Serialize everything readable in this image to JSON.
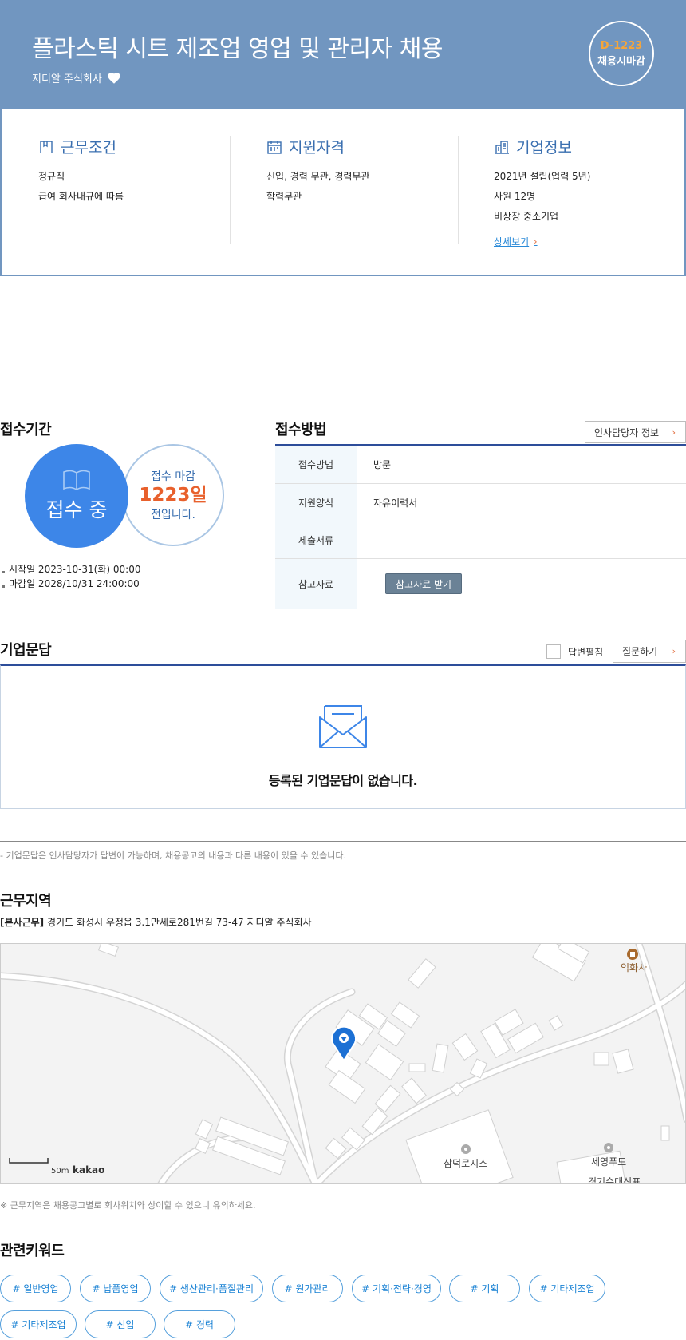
{
  "header": {
    "title": "플라스틱 시트 제조업 영업 및 관리자 채용",
    "company": "지디알 주식회사",
    "dday": "D-1223",
    "deadline_type": "채용시마감"
  },
  "summary": {
    "work": {
      "title": "근무조건",
      "lines": [
        "정규직",
        "급여 회사내규에 따름"
      ]
    },
    "qualification": {
      "title": "지원자격",
      "lines": [
        "신입, 경력 무관, 경력무관",
        "학력무관"
      ]
    },
    "company_info": {
      "title": "기업정보",
      "lines": [
        "2021년 설립(업력 5년)",
        "사원 12명",
        "비상장 중소기업"
      ],
      "more": "상세보기"
    }
  },
  "period": {
    "title": "접수기간",
    "status": "접수 중",
    "line1": "접수 마감",
    "days": "1223일",
    "line2": "전입니다.",
    "start": "시작일 2023-10-31(화) 00:00",
    "end": "마감일 2028/10/31 24:00:00"
  },
  "method": {
    "title": "접수방법",
    "hr_button": "인사담당자 정보",
    "rows": [
      {
        "label": "접수방법",
        "value": "방문"
      },
      {
        "label": "지원양식",
        "value": "자유이력서"
      },
      {
        "label": "제출서류",
        "value": ""
      },
      {
        "label": "참고자료",
        "button": "참고자료 받기"
      }
    ]
  },
  "qa": {
    "title": "기업문답",
    "expand_label": "답변펼침",
    "ask_button": "질문하기",
    "empty": "등록된 기업문답이 없습니다.",
    "note": "- 기업문답은 인사담당자가 답변이 가능하며, 채용공고의 내용과 다른 내용이 있을 수 있습니다."
  },
  "location": {
    "title": "근무지역",
    "tag": "[본사근무]",
    "address": "경기도 화성시 우정읍 3.1만세로281번길 73-47 지디알 주식회사",
    "map_labels": [
      "익화사",
      "삼덕로지스",
      "세영푸드",
      "경기수대신표"
    ],
    "scale": "50m",
    "provider": "kakao",
    "note": "※ 근무지역은 채용공고별로 회사위치와 상이할 수 있으니 유의하세요."
  },
  "keywords": {
    "title": "관련키워드",
    "items": [
      "# 일반영업",
      "# 납품영업",
      "# 생산관리·품질관리",
      "# 원가관리",
      "# 기획·전략·경영",
      "# 기획",
      "# 기타제조업",
      "# 기타제조업",
      "# 신입",
      "# 경력"
    ]
  },
  "colors": {
    "header_bg": "#7196c0",
    "accent_blue": "#3d86e8",
    "accent_orange": "#e8602c",
    "dday_orange": "#f5a53a"
  }
}
